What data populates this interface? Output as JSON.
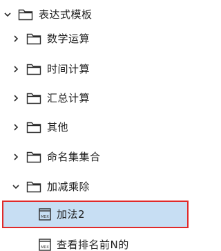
{
  "tree": {
    "root": {
      "label": "表达式模板",
      "icon": "folder-icon",
      "state": "expanded"
    },
    "folders": [
      {
        "label": "数学运算",
        "icon": "folder-icon",
        "state": "collapsed"
      },
      {
        "label": "时间计算",
        "icon": "folder-icon",
        "state": "collapsed"
      },
      {
        "label": "汇总计算",
        "icon": "folder-icon",
        "state": "collapsed"
      },
      {
        "label": "其他",
        "icon": "folder-icon",
        "state": "collapsed"
      },
      {
        "label": "命名集集合",
        "icon": "folder-icon",
        "state": "collapsed"
      },
      {
        "label": "加减乘除",
        "icon": "folder-icon",
        "state": "expanded"
      }
    ],
    "items": [
      {
        "label": "加法2",
        "icon": "mdx-file-icon",
        "icon_text": "MDX",
        "selected": true
      },
      {
        "label": "查看排名前N的",
        "icon": "mdx-file-icon",
        "icon_text": "MDX",
        "selected": false
      }
    ]
  },
  "colors": {
    "selection_bg": "#c7def3",
    "selection_border": "#e02a2a",
    "text": "#1f1f1f",
    "icon": "#2b2b2b"
  }
}
